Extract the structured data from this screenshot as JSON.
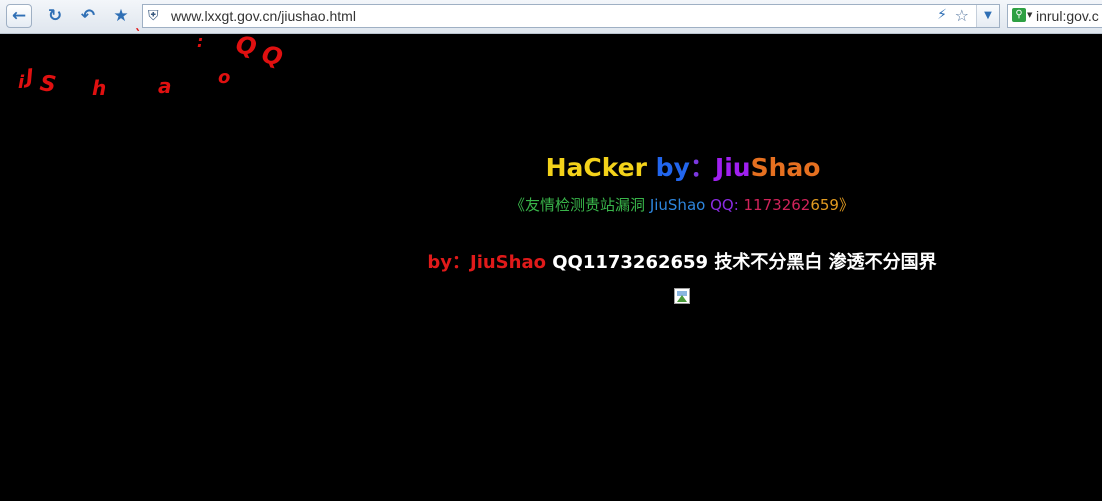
{
  "browser": {
    "url": "www.lxxgt.gov.cn/jiushao.html",
    "search_text": "inrul:gov.c",
    "icons": [
      "back-icon",
      "refresh-icon",
      "undo-icon",
      "favorites-star-icon",
      "shield-icon",
      "bolt-icon",
      "star-icon",
      "dropdown-icon",
      "search-engine-icon"
    ]
  },
  "floating_text": {
    "letters": [
      "i",
      "J",
      "S",
      "h",
      "a",
      "o",
      "Q",
      "Q",
      ":",
      "`"
    ],
    "color": "#e01010"
  },
  "page": {
    "title_parts": [
      {
        "text": "HaCker",
        "color": "#f3d21a"
      },
      {
        "text": " by",
        "color": "#2266ee"
      },
      {
        "text": "：",
        "color": "#7b38e0"
      },
      {
        "text": "Jiu",
        "color": "#a020f0"
      },
      {
        "text": "Shao",
        "color": "#e67020"
      }
    ],
    "subtitle_parts": [
      {
        "text": "《友情检测贵站漏洞 ",
        "color": "#39b54a"
      },
      {
        "text": "JiuShao",
        "color": "#2e86de"
      },
      {
        "text": " QQ: ",
        "color": "#8a2be2"
      },
      {
        "text": "1173262",
        "color": "#d1235a"
      },
      {
        "text": "659》",
        "color": "#e09a20"
      }
    ],
    "motto_prefix": "by：JiuShao",
    "motto_prefix_color": "#e01a1a",
    "motto_rest": " QQ1173262659 技术不分黑白 渗透不分国界"
  }
}
